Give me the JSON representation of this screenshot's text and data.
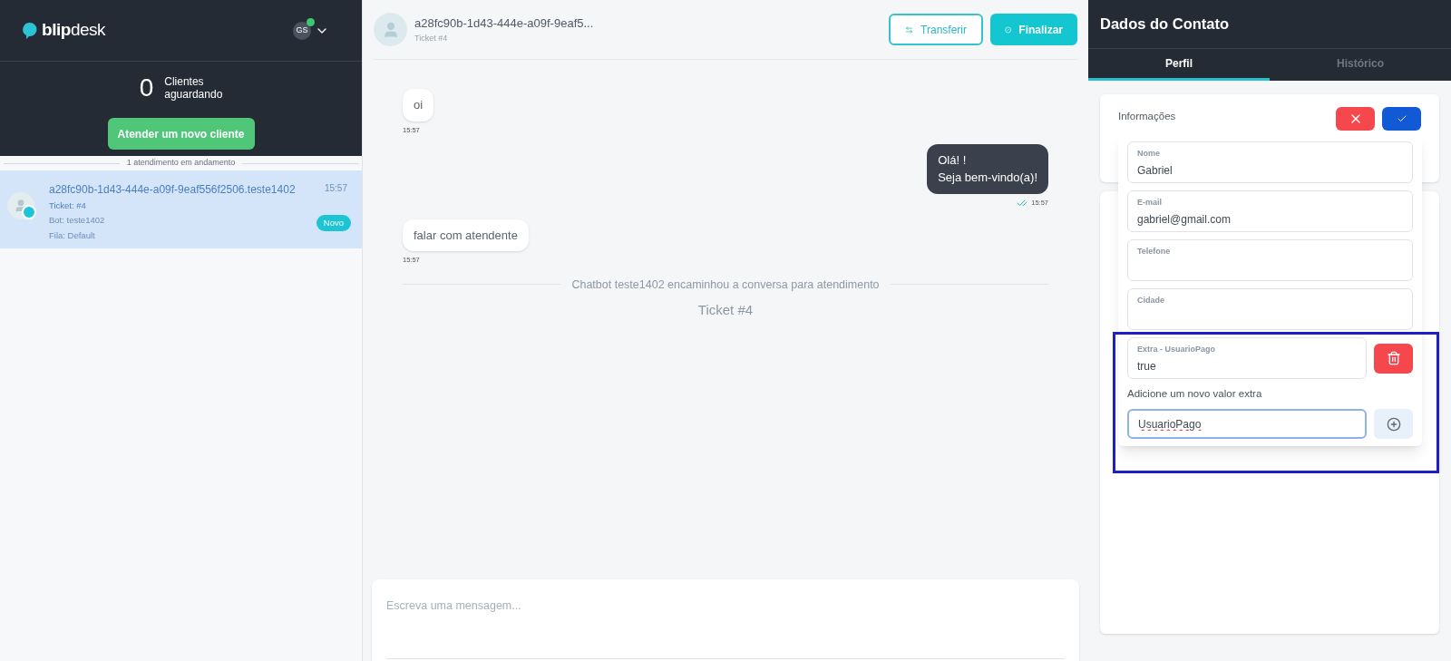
{
  "sidebar": {
    "logo": {
      "bold": "blip",
      "light": "desk"
    },
    "user": {
      "initials": "GS",
      "online": true
    },
    "waiting": {
      "count": "0",
      "label_1": "Clientes",
      "label_2": "aguardando"
    },
    "new_client_button": "Atender um novo cliente",
    "section_label": "1 atendimento em andamento",
    "tickets": [
      {
        "title": "a28fc90b-1d43-444e-a09f-9eaf556f2506.teste1402",
        "time": "15:57",
        "ticket": "Ticket: #4",
        "bot": "Bot: teste1402",
        "queue": "Fila: Default",
        "badge": "Novo",
        "selected": true
      }
    ]
  },
  "chat": {
    "header": {
      "title": "a28fc90b-1d43-444e-a09f-9eaf5...",
      "subtitle": "Ticket #4",
      "buttons": [
        {
          "kind": "outline",
          "label": "Transferir"
        },
        {
          "kind": "solid",
          "label": "Finalizar"
        }
      ]
    },
    "messages": [
      {
        "kind": "incoming",
        "lines": [
          "oi"
        ],
        "time": "15:57"
      },
      {
        "kind": "outgoing",
        "lines": [
          "Olá! !",
          "Seja bem-vindo(a)!"
        ],
        "time": "15:57",
        "read": true
      },
      {
        "kind": "incoming",
        "lines": [
          "falar com atendente"
        ],
        "time": "15:57"
      },
      {
        "kind": "notice",
        "lines": [
          "Chatbot teste1402 encaminhou a conversa para atendimento"
        ]
      },
      {
        "kind": "ticket",
        "lines": [
          "Ticket #4"
        ]
      }
    ],
    "composer": {
      "placeholder": "Escreva uma mensagem..."
    }
  },
  "contact_panel": {
    "title": "Dados do Contato",
    "tabs": [
      {
        "label": "Perfil",
        "selected": true
      },
      {
        "label": "Histórico",
        "selected": false
      }
    ],
    "info_title": "Informações",
    "fields": [
      {
        "label": "Nome",
        "value": "Gabriel"
      },
      {
        "label": "E-mail",
        "value": "gabriel@gmail.com"
      },
      {
        "label": "Telefone"
      },
      {
        "label": "Cidade"
      }
    ],
    "extras": [
      {
        "label": "Extra - UsuarioPago",
        "value": "true"
      }
    ],
    "add_extra_label": "Adicione um novo valor extra",
    "add_extra_value": "UsuarioPago",
    "highlight": true
  }
}
